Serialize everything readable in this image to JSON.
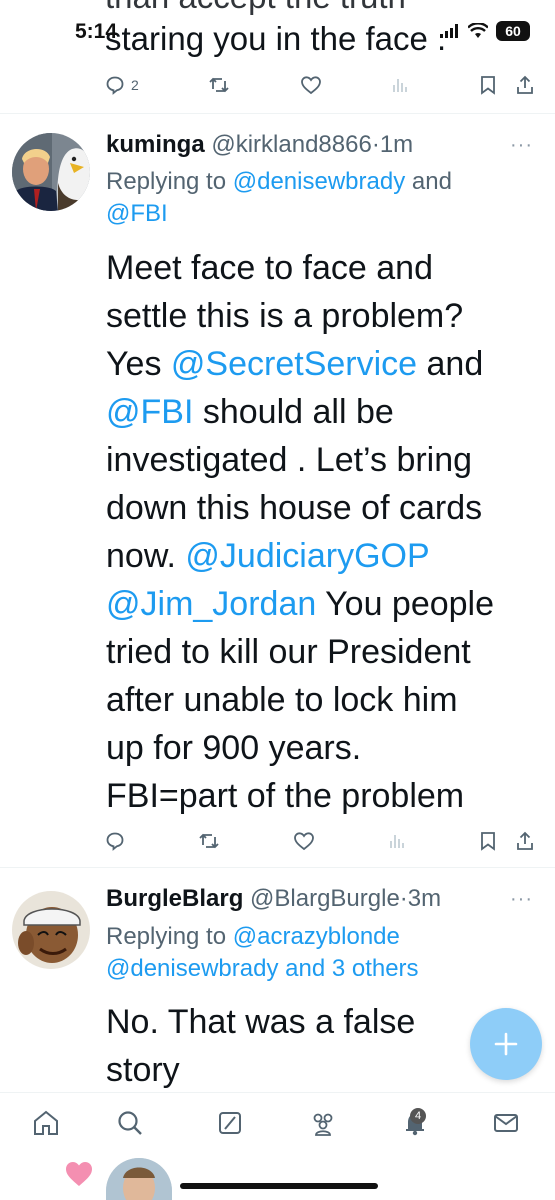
{
  "status_bar": {
    "time": "5:14",
    "battery": "60"
  },
  "prev_tweet": {
    "text_cut": "than accept the truth",
    "text_last": "staring you in the face .",
    "reply_count": "2"
  },
  "tweet1": {
    "name": "kuminga",
    "handle": "@kirkland8866",
    "time": "1m",
    "replying_label": "Replying to",
    "replying_to_1": "@denisewbrady",
    "replying_and": "and",
    "replying_to_2": "@FBI",
    "lines": [
      {
        "text": "Meet face to face and"
      },
      {
        "text": "settle this is a problem?"
      },
      {
        "pre": "Yes ",
        "mention": "@SecretService",
        "post": " and"
      },
      {
        "pre": "",
        "mention": "@FBI",
        "post": " should all be"
      },
      {
        "text": "investigated . Let’s bring"
      },
      {
        "text": "down this house of cards"
      },
      {
        "pre": "now. ",
        "mention": "@JudiciaryGOP",
        "post": ""
      },
      {
        "pre": "",
        "mention": "@Jim_Jordan",
        "post": " You people"
      },
      {
        "text": "tried to kill our President"
      },
      {
        "text": "after unable to lock him"
      },
      {
        "text": "up for 900 years."
      },
      {
        "text": "FBI=part of the problem"
      }
    ]
  },
  "tweet2": {
    "name": "BurgleBlarg",
    "handle": "@BlargBurgle",
    "time": "3m",
    "replying_label": "Replying to",
    "replying_to_1": "@acrazyblonde",
    "replying_to_2": "@denisewbrady and 3 others",
    "line1": "No. That was a false",
    "line2": "story"
  },
  "nav": {
    "notification_count": "4"
  },
  "colors": {
    "link": "#1d9bf0",
    "muted": "#536471",
    "fab": "#8ecdf8"
  }
}
